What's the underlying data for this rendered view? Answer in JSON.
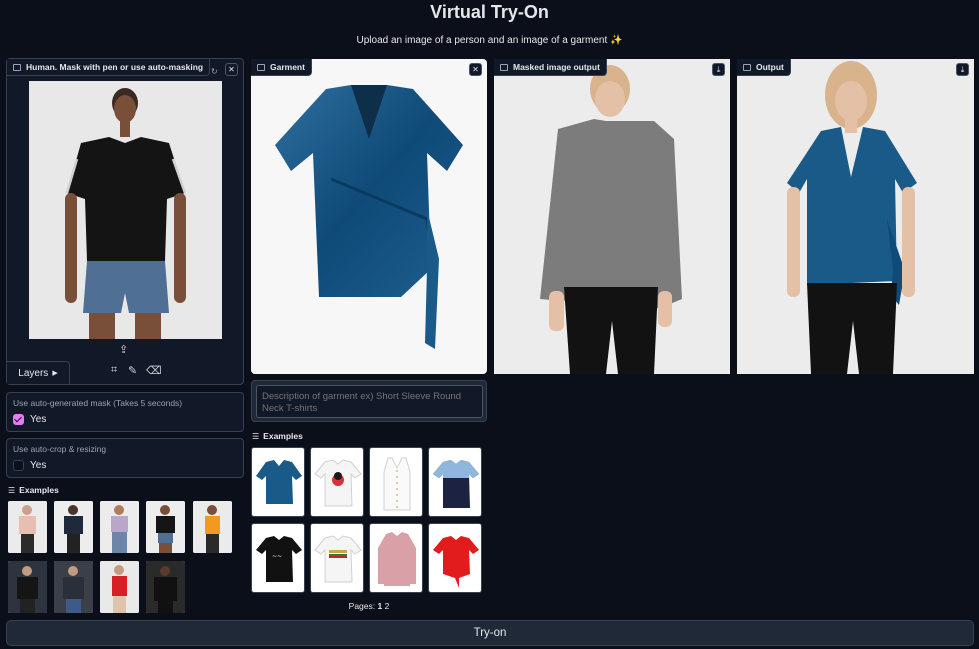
{
  "header": {
    "title": "Virtual Try-On",
    "subtitle": "Upload an image of a person and an image of a garment ✨"
  },
  "human_panel": {
    "label": "Human. Mask with pen or use auto-masking",
    "layers_label": "Layers"
  },
  "options": {
    "auto_mask": {
      "label": "Use auto-generated mask (Takes 5 seconds)",
      "value_label": "Yes",
      "checked": true
    },
    "auto_crop": {
      "label": "Use auto-crop & resizing",
      "value_label": "Yes",
      "checked": false
    }
  },
  "human_examples": {
    "heading": "Examples"
  },
  "garment_panel": {
    "label": "Garment"
  },
  "masked_panel": {
    "label": "Masked image output"
  },
  "output_panel": {
    "label": "Output"
  },
  "description": {
    "placeholder": "Description of garment ex) Short Sleeve Round Neck T-shirts"
  },
  "garment_examples": {
    "heading": "Examples"
  },
  "pagination": {
    "label": "Pages:",
    "pages": [
      "1",
      "2"
    ]
  },
  "action": {
    "tryon_label": "Try-on"
  },
  "colors": {
    "accent": "#e879f9",
    "background": "#0b0f19",
    "panel": "#1f2937"
  }
}
